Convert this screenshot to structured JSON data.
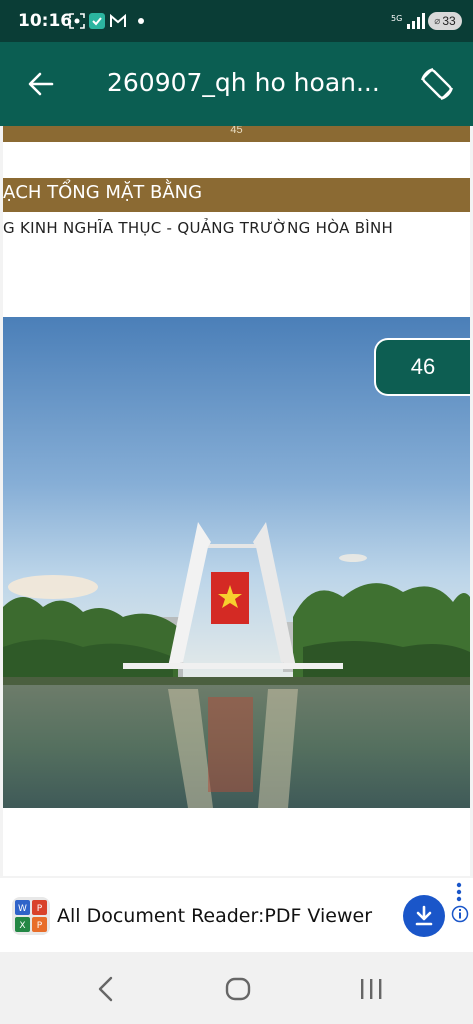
{
  "status_bar": {
    "time": "10:16",
    "battery": "33"
  },
  "app_bar": {
    "title": "260907_qh ho hoan...",
    "back_icon": "arrow-left-icon",
    "rotate_icon": "screen-rotation-icon"
  },
  "document": {
    "prev_page_number": "45",
    "heading": "ẠCH TỔNG MẶT BẰNG",
    "subheading": "G KINH NGHĨA THỤC - QUẢNG TRƯỜNG HÒA BÌNH",
    "current_page": "46",
    "image_subject": "monument-photo"
  },
  "ad": {
    "title": "All Document Reader:PDF Viewer",
    "app_icon": "office-docs-icon",
    "download_icon": "download-icon",
    "info_icon": "info-icon"
  },
  "colors": {
    "status_bar": "#0a3d36",
    "app_bar": "#0b5e52",
    "heading_band": "#8b6a33",
    "badge": "#0d5e52",
    "download_button": "#1a56c9"
  }
}
